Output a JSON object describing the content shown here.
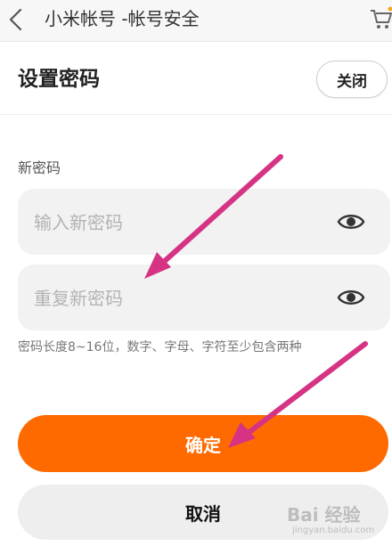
{
  "topbar": {
    "title": "小米帐号 -帐号安全",
    "back_icon": "chevron-left-icon",
    "cart_icon": "cart-icon"
  },
  "sheet": {
    "title": "设置密码",
    "close_label": "关闭"
  },
  "form": {
    "section_label": "新密码",
    "new_password": {
      "value": "",
      "placeholder": "输入新密码",
      "icon": "eye-icon"
    },
    "repeat_password": {
      "value": "",
      "placeholder": "重复新密码",
      "icon": "eye-icon"
    },
    "hint": "密码长度8~16位，数字、字母、字符至少包含两种"
  },
  "actions": {
    "confirm_label": "确定",
    "cancel_label": "取消"
  },
  "watermark": {
    "text": "Bai 经验",
    "subtext": "jingyan.baidu.com"
  },
  "colors": {
    "accent": "#ff6a00",
    "annotation_arrow": "#d63384",
    "field_bg": "#f2f2f2"
  }
}
